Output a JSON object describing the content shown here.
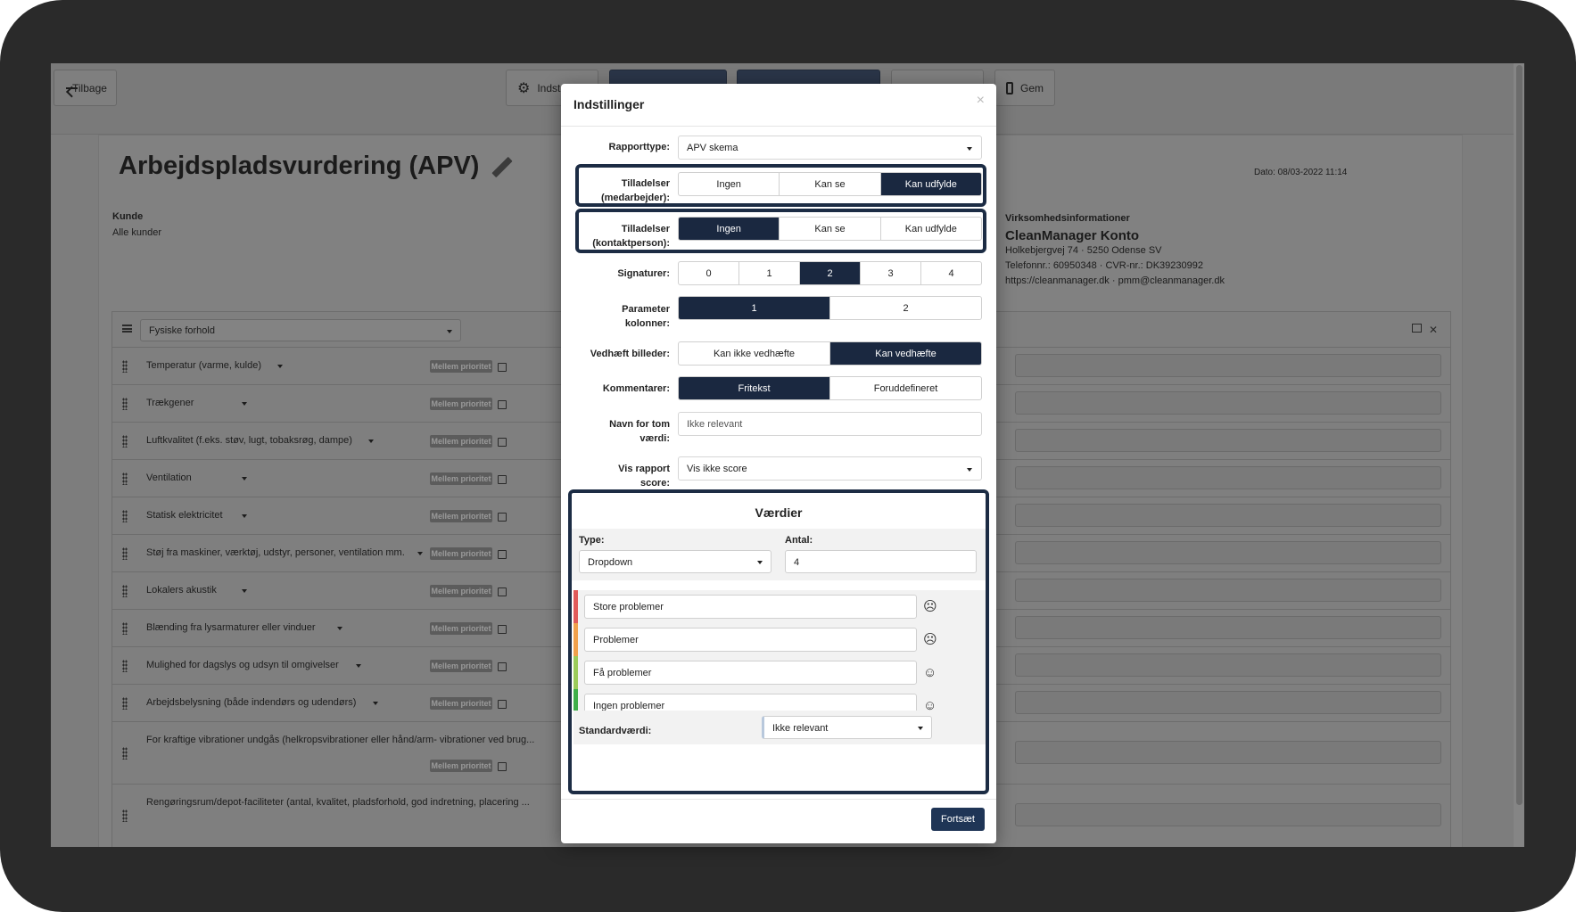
{
  "toolbar": {
    "back_label": "Tilbage",
    "settings_label": "Indst",
    "save_label": "Gem"
  },
  "document": {
    "title": "Arbejdspladsvurdering (APV)",
    "date": "Dato: 08/03-2022 11:14",
    "customer_label": "Kunde",
    "customer_value": "Alle kunder",
    "company": {
      "heading": "Virksomhedsinformationer",
      "name": "CleanManager Konto",
      "address": "Holkebjergvej 74 · 5250 Odense SV",
      "phone": "Telefonnr.: 60950348 · CVR-nr.: DK39230992",
      "web": "https://cleanmanager.dk · pmm@cleanmanager.dk"
    }
  },
  "panel": {
    "category": "Fysiske forhold",
    "priority_badge": "Mellem prioritet",
    "items": [
      "Temperatur (varme, kulde)",
      "Trækgener",
      "Luftkvalitet (f.eks. støv, lugt, tobaksrøg, dampe)",
      "Ventilation",
      "Statisk elektricitet",
      "Støj fra maskiner, værktøj, udstyr, personer, ventilation mm.",
      "Lokalers akustik",
      "Blænding fra lysarmaturer eller vinduer",
      "Mulighed for dagslys og udsyn til omgivelser",
      "Arbejdsbelysning (både indendørs og udendørs)",
      "For kraftige vibrationer undgås (helkropsvibrationer eller hånd/arm- vibrationer ved brug...",
      "Rengøringsrum/depot-faciliteter (antal, kvalitet, pladsforhold, god indretning, placering ..."
    ]
  },
  "modal": {
    "title": "Indstillinger",
    "close": "×",
    "report_type": {
      "label": "Rapporttype:",
      "value": "APV skema"
    },
    "perm_employee": {
      "label1": "Tilladelser",
      "label2": "(medarbejder):",
      "options": [
        "Ingen",
        "Kan se",
        "Kan udfylde"
      ],
      "selected": 2
    },
    "perm_contact": {
      "label1": "Tilladelser",
      "label2": "(kontaktperson):",
      "options": [
        "Ingen",
        "Kan se",
        "Kan udfylde"
      ],
      "selected": 0
    },
    "signatures": {
      "label": "Signaturer:",
      "options": [
        "0",
        "1",
        "2",
        "3",
        "4"
      ],
      "selected": 2
    },
    "param_columns": {
      "label1": "Parameter",
      "label2": "kolonner:",
      "options": [
        "1",
        "2"
      ],
      "selected": 0
    },
    "attach_images": {
      "label": "Vedhæft billeder:",
      "options": [
        "Kan ikke vedhæfte",
        "Kan vedhæfte"
      ],
      "selected": 1
    },
    "comments": {
      "label": "Kommentarer:",
      "options": [
        "Fritekst",
        "Foruddefineret"
      ],
      "selected": 0
    },
    "empty_value_name": {
      "label1": "Navn for tom",
      "label2": "værdi:",
      "value": "Ikke relevant"
    },
    "show_score": {
      "label1": "Vis rapport",
      "label2": "score:",
      "value": "Vis ikke score"
    },
    "values": {
      "title": "Værdier",
      "type_label": "Type:",
      "type_value": "Dropdown",
      "count_label": "Antal:",
      "count_value": "4",
      "rows": [
        {
          "text": "Store problemer",
          "color": "#e05a5a",
          "icon": "very-sad-face-icon",
          "glyph": "☹"
        },
        {
          "text": "Problemer",
          "color": "#f0a04b",
          "icon": "sad-face-icon",
          "glyph": "☹"
        },
        {
          "text": "Få problemer",
          "color": "#9bcb5a",
          "icon": "neutral-face-icon",
          "glyph": "☺"
        },
        {
          "text": "Ingen problemer",
          "color": "#3fae49",
          "icon": "happy-face-icon",
          "glyph": "☺"
        }
      ],
      "default_label": "Standardværdi:",
      "default_value": "Ikke relevant"
    },
    "submit_label": "Fortsæt"
  }
}
